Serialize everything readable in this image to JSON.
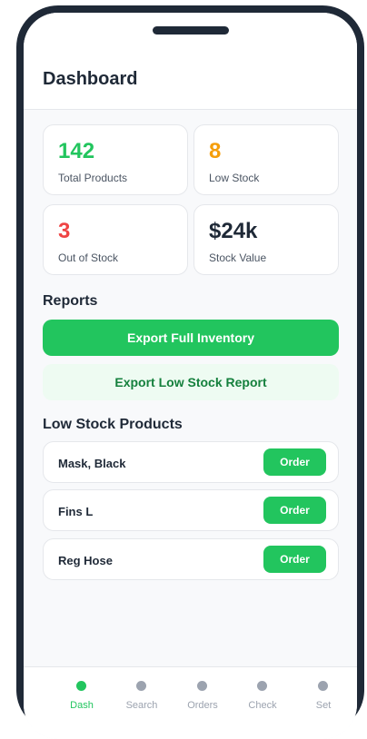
{
  "header": {
    "title": "Dashboard"
  },
  "stats": [
    {
      "value": "142",
      "label": "Total Products",
      "color": "#22c55e"
    },
    {
      "value": "8",
      "label": "Low Stock",
      "color": "#f59e0b"
    },
    {
      "value": "3",
      "label": "Out of Stock",
      "color": "#ef4444"
    },
    {
      "value": "$24k",
      "label": "Stock Value",
      "color": "#1f2937"
    }
  ],
  "reports": {
    "title": "Reports",
    "export_full_label": "Export Full Inventory",
    "export_low_label": "Export Low Stock Report"
  },
  "low_stock": {
    "title": "Low Stock Products",
    "items": [
      {
        "name": "Mask, Black",
        "action": "Order"
      },
      {
        "name": "Fins L",
        "action": "Order"
      },
      {
        "name": "Reg Hose",
        "action": "Order"
      }
    ]
  },
  "nav": {
    "active": "Dash",
    "items": [
      {
        "label": "Dash"
      },
      {
        "label": "Search"
      },
      {
        "label": "Orders"
      },
      {
        "label": "Check"
      },
      {
        "label": "Set"
      }
    ]
  },
  "colors": {
    "accent": "#22c55e",
    "warning": "#f59e0b",
    "danger": "#ef4444",
    "text": "#1f2937",
    "inactive": "#9ca3af"
  }
}
